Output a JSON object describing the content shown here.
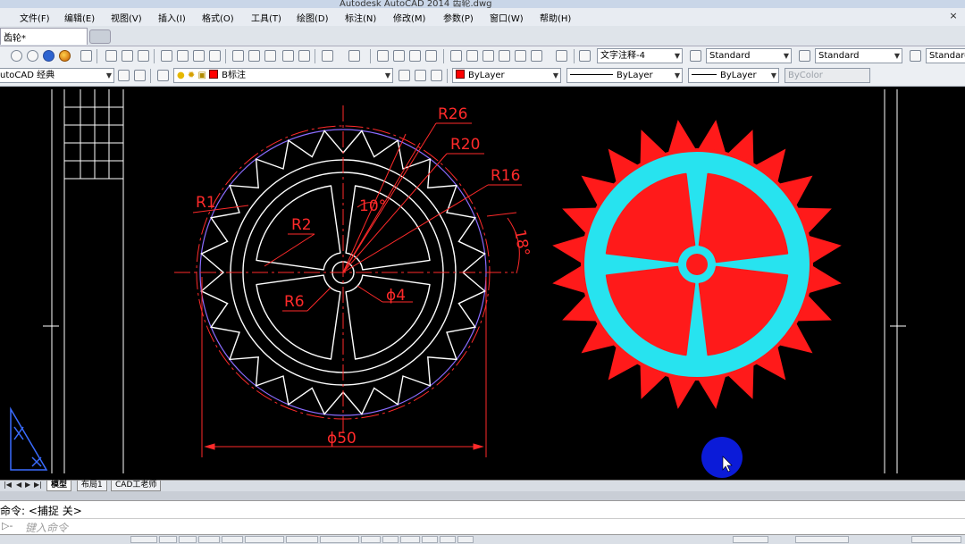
{
  "window": {
    "title": "Autodesk AutoCAD 2014    齿轮.dwg"
  },
  "menu": [
    "文件(F)",
    "编辑(E)",
    "视图(V)",
    "插入(I)",
    "格式(O)",
    "工具(T)",
    "绘图(D)",
    "标注(N)",
    "修改(M)",
    "参数(P)",
    "窗口(W)",
    "帮助(H)"
  ],
  "doc_tab": {
    "label": "齿轮*",
    "close": "×"
  },
  "toolbar1": {
    "text_style": "文字注释-4",
    "dim_style": "Standard",
    "table_style": "Standard",
    "mleader_style": "Standard"
  },
  "toolbar2": {
    "workspace": "utoCAD 经典",
    "layer": "B标注",
    "color": "ByLayer",
    "linetype": "ByLayer",
    "lineweight": "ByLayer",
    "plotstyle": "ByColor"
  },
  "drawing": {
    "labels": {
      "r26": "R26",
      "r20": "R20",
      "r16": "R16",
      "r1": "R1",
      "r2": "R2",
      "r6": "R6",
      "angle10": "10°",
      "angle18": "18°",
      "dia4": "ϕ4",
      "dia50": "ϕ50"
    },
    "colors": {
      "dimension": "#ff2a2a",
      "outline": "#ffffff",
      "teeth_fill": "#ff1a1a",
      "ring_fill": "#27e3ef",
      "outer_circle": "#8a6cff",
      "cursor_highlight": "#0b1bd8"
    },
    "gear_teeth": 24
  },
  "layout_tabs": [
    {
      "label": "模型",
      "active": true
    },
    {
      "label": "布局1",
      "active": false
    },
    {
      "label": "CAD工老师",
      "active": false
    }
  ],
  "layout_nav": [
    "|◀",
    "◀",
    "▶",
    "▶|"
  ],
  "command": {
    "history": "命令:  <捕捉 关>",
    "prefix": "▷-",
    "placeholder": "键入命令"
  },
  "icons": [
    "new-icon",
    "open-icon",
    "save-icon",
    "plot-icon",
    "undo-icon",
    "redo-icon",
    "pan-icon",
    "zoom-icon",
    "layer-icon",
    "lightbulb-icon",
    "sun-icon",
    "lock-icon",
    "match-properties-icon",
    "ucs-icon",
    "cursor-icon"
  ]
}
